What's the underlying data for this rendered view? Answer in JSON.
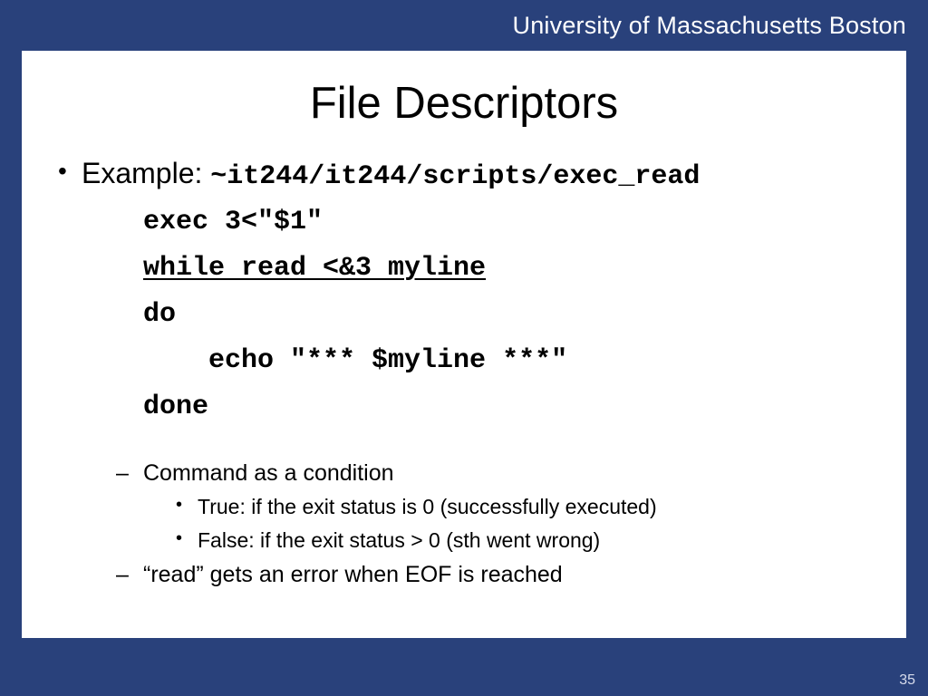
{
  "header": {
    "org": "University of Massachusetts Boston"
  },
  "title": "File Descriptors",
  "bullet1": {
    "label": "Example: ",
    "path": "~it244/it244/scripts/exec_read"
  },
  "code": {
    "l1": "exec 3<\"$1\"",
    "l2": "while read <&3 myline",
    "l3": "do",
    "l4": "    echo \"*** $myline ***\"",
    "l5": "done"
  },
  "notes": {
    "s1": "Command as a condition",
    "s1a": "True: if the exit status is 0 (successfully executed)",
    "s1b": "False: if the exit status > 0 (sth went wrong)",
    "s2": "“read” gets an error when EOF is reached"
  },
  "page": "35"
}
